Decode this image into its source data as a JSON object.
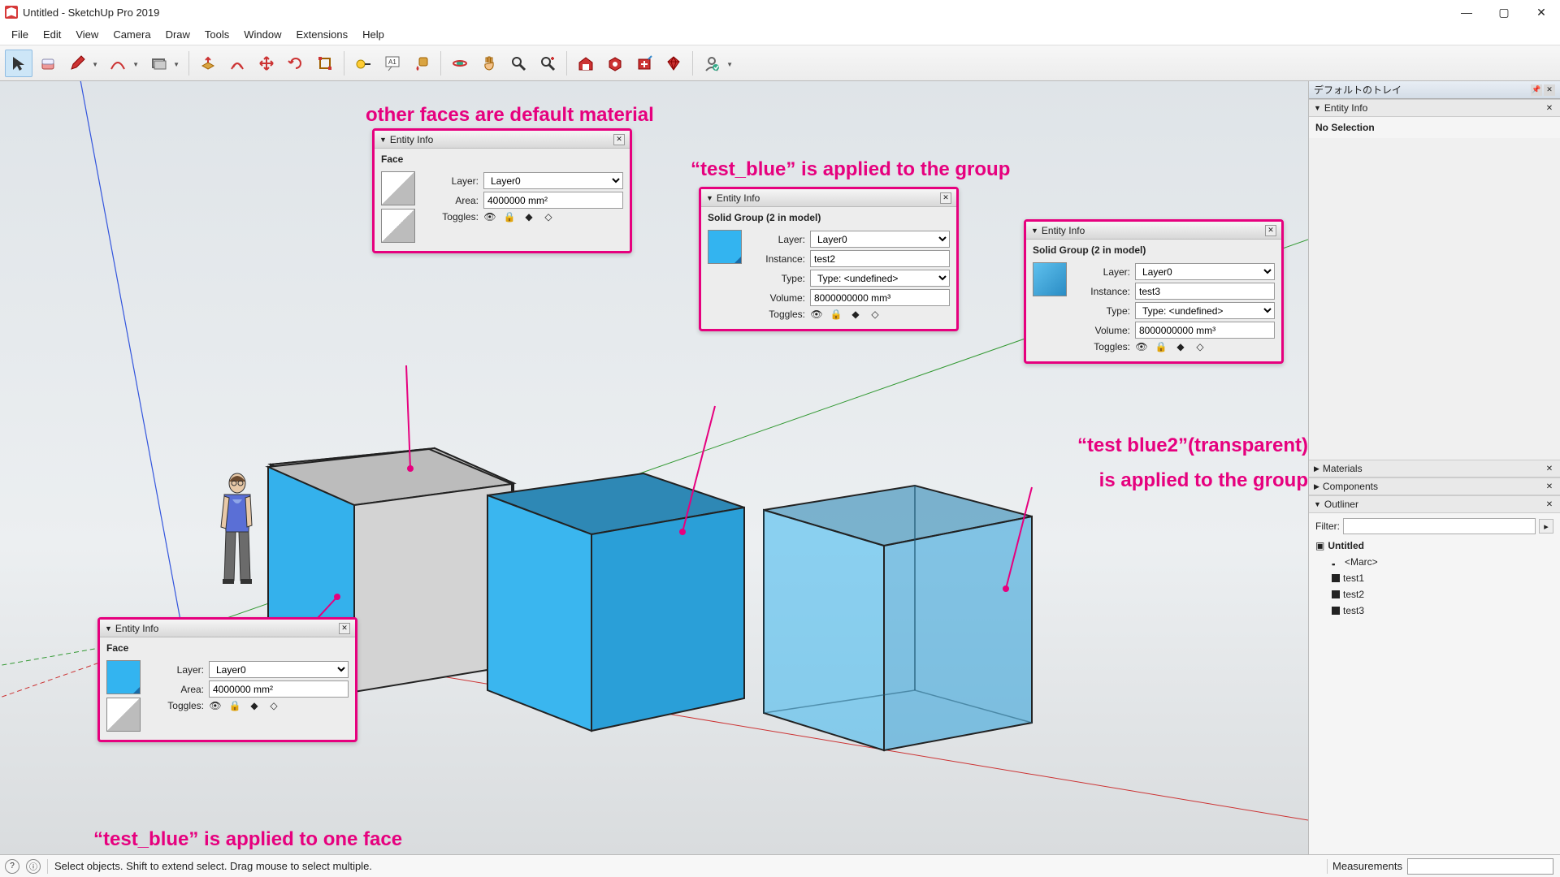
{
  "app_icon": "sketchup",
  "window_title": "Untitled - SketchUp Pro 2019",
  "menu": [
    "File",
    "Edit",
    "View",
    "Camera",
    "Draw",
    "Tools",
    "Window",
    "Extensions",
    "Help"
  ],
  "toolbar": [
    {
      "name": "select",
      "sel": true
    },
    {
      "name": "eraser"
    },
    {
      "name": "pencil",
      "drop": true
    },
    {
      "name": "arc",
      "drop": true
    },
    {
      "name": "rectangle",
      "drop": true
    },
    {
      "sep": true
    },
    {
      "name": "pushpull"
    },
    {
      "name": "offset"
    },
    {
      "name": "move"
    },
    {
      "name": "rotate"
    },
    {
      "name": "scale"
    },
    {
      "sep": true
    },
    {
      "name": "tape"
    },
    {
      "name": "text"
    },
    {
      "name": "paint"
    },
    {
      "sep": true
    },
    {
      "name": "orbit"
    },
    {
      "name": "pan"
    },
    {
      "name": "zoom"
    },
    {
      "name": "zoom-extents"
    },
    {
      "sep": true
    },
    {
      "name": "warehouse"
    },
    {
      "name": "share-model"
    },
    {
      "name": "trimble"
    },
    {
      "name": "ruby"
    },
    {
      "sep": true
    },
    {
      "name": "user",
      "drop": true
    }
  ],
  "tray": {
    "title": "デフォルトのトレイ",
    "entity_info": {
      "title": "Entity Info",
      "body": "No Selection"
    },
    "panels": [
      "Materials",
      "Components",
      "Outliner"
    ],
    "outliner": {
      "filter_label": "Filter:",
      "root": "Untitled",
      "items": [
        "<Marc>",
        "test1",
        "test2",
        "test3"
      ]
    }
  },
  "status": {
    "hint": "Select objects. Shift to extend select. Drag mouse to select multiple.",
    "measurements_label": "Measurements"
  },
  "annotations": {
    "top": "other faces are default material",
    "mid": "“test_blue” is applied to the group",
    "right1": "“test blue2”(transparent)",
    "right2": "is applied to the group",
    "bottom": "“test_blue” is applied to one face"
  },
  "panels": {
    "p1": {
      "title": "Entity Info",
      "subtitle": "Face",
      "layer_lbl": "Layer:",
      "layer": "Layer0",
      "area_lbl": "Area:",
      "area": "4000000 mm²",
      "toggles_lbl": "Toggles:"
    },
    "p2": {
      "title": "Entity Info",
      "subtitle": "Face",
      "layer_lbl": "Layer:",
      "layer": "Layer0",
      "area_lbl": "Area:",
      "area": "4000000 mm²",
      "toggles_lbl": "Toggles:"
    },
    "p3": {
      "title": "Entity Info",
      "subtitle": "Solid Group (2 in model)",
      "layer_lbl": "Layer:",
      "layer": "Layer0",
      "instance_lbl": "Instance:",
      "instance": "test2",
      "type_lbl": "Type:",
      "type": "Type: <undefined>",
      "volume_lbl": "Volume:",
      "volume": "8000000000 mm³",
      "toggles_lbl": "Toggles:"
    },
    "p4": {
      "title": "Entity Info",
      "subtitle": "Solid Group (2 in model)",
      "layer_lbl": "Layer:",
      "layer": "Layer0",
      "instance_lbl": "Instance:",
      "instance": "test3",
      "type_lbl": "Type:",
      "type": "Type: <undefined>",
      "volume_lbl": "Volume:",
      "volume": "8000000000 mm³",
      "toggles_lbl": "Toggles:"
    }
  }
}
